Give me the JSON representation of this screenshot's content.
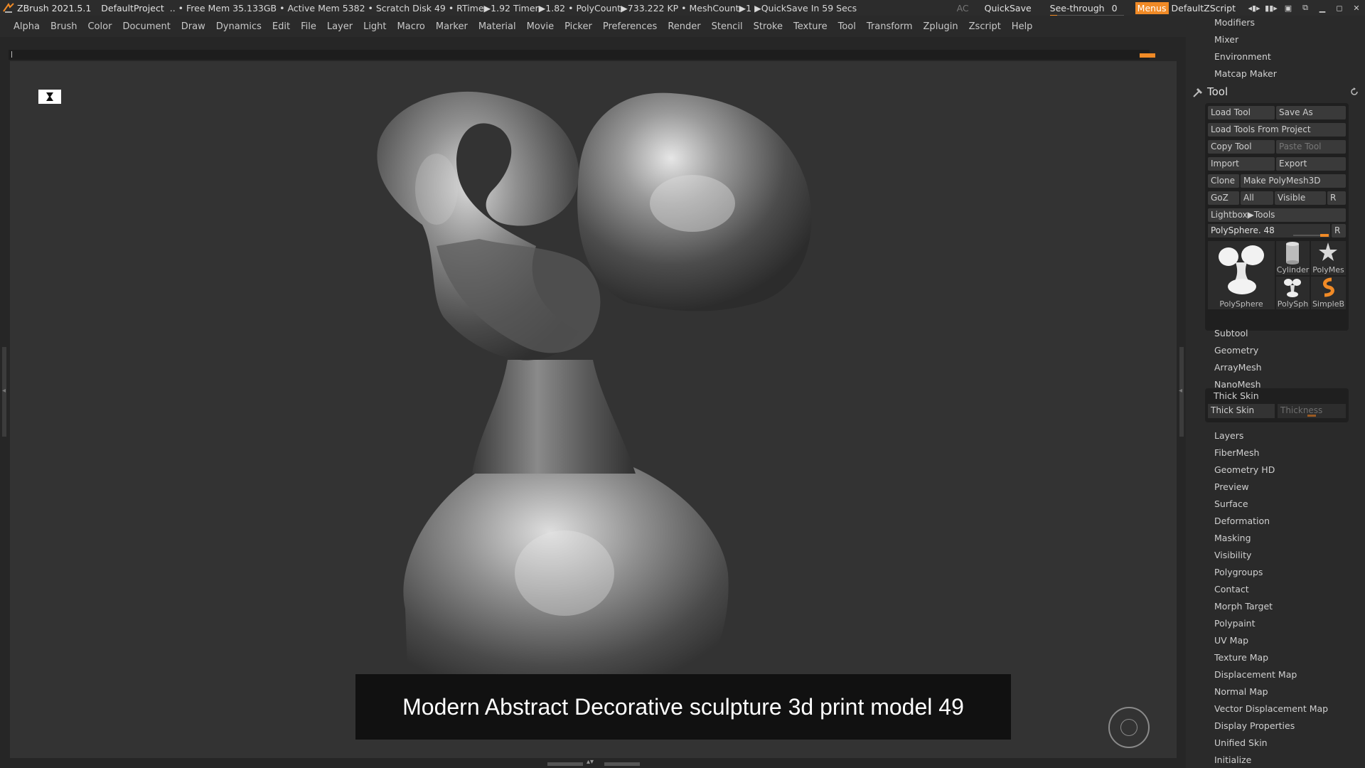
{
  "titlebar": {
    "app": "ZBrush 2021.5.1",
    "project": "DefaultProject",
    "stats": ".. • Free Mem 35.133GB • Active Mem 5382 • Scratch Disk 49 •  RTime▶1.92 Timer▶1.82 • PolyCount▶733.222 KP  • MeshCount▶1  ▶QuickSave In 59 Secs",
    "ac": "AC",
    "quicksave": "QuickSave",
    "seethrough_label": "See-through",
    "seethrough_value": "0",
    "seethrough_level": 0,
    "menus": "Menus",
    "zscript": "DefaultZScript",
    "accent": "#f08a26"
  },
  "menubar": {
    "items": [
      "Alpha",
      "Brush",
      "Color",
      "Document",
      "Draw",
      "Dynamics",
      "Edit",
      "File",
      "Layer",
      "Light",
      "Macro",
      "Marker",
      "Material",
      "Movie",
      "Picker",
      "Preferences",
      "Render",
      "Stencil",
      "Stroke",
      "Texture",
      "Tool",
      "Transform",
      "Zplugin",
      "Zscript",
      "Help"
    ]
  },
  "viewport": {
    "caption": "Modern Abstract Decorative sculpture 3d print model 49"
  },
  "rightpanel": {
    "top_items": [
      "Modifiers",
      "Mixer",
      "Environment",
      "Matcap Maker"
    ],
    "tool_title": "Tool",
    "buttons": {
      "load_tool": "Load Tool",
      "save_as": "Save As",
      "load_from_project": "Load Tools From Project",
      "copy_tool": "Copy Tool",
      "paste_tool": "Paste Tool",
      "import": "Import",
      "export": "Export",
      "clone": "Clone",
      "make_polymesh": "Make PolyMesh3D",
      "goz": "GoZ",
      "all": "All",
      "visible": "Visible",
      "r": "R",
      "lightbox": "Lightbox▶Tools"
    },
    "current_tool": "PolySphere. 48",
    "current_tool_r": "R",
    "thumbs": [
      "PolySphere",
      "Cylinder",
      "PolyMes",
      "PolySph",
      "SimpleB"
    ],
    "sections": [
      "Subtool",
      "Geometry",
      "ArrayMesh",
      "NanoMesh"
    ],
    "thick_skin": {
      "header": "Thick Skin",
      "button": "Thick Skin",
      "slider": "Thickness"
    },
    "sections2": [
      "Layers",
      "FiberMesh",
      "Geometry HD",
      "Preview",
      "Surface",
      "Deformation",
      "Masking",
      "Visibility",
      "Polygroups",
      "Contact",
      "Morph Target",
      "Polypaint",
      "UV Map",
      "Texture Map",
      "Displacement Map",
      "Normal Map",
      "Vector Displacement Map",
      "Display Properties",
      "Unified Skin",
      "Initialize"
    ]
  }
}
